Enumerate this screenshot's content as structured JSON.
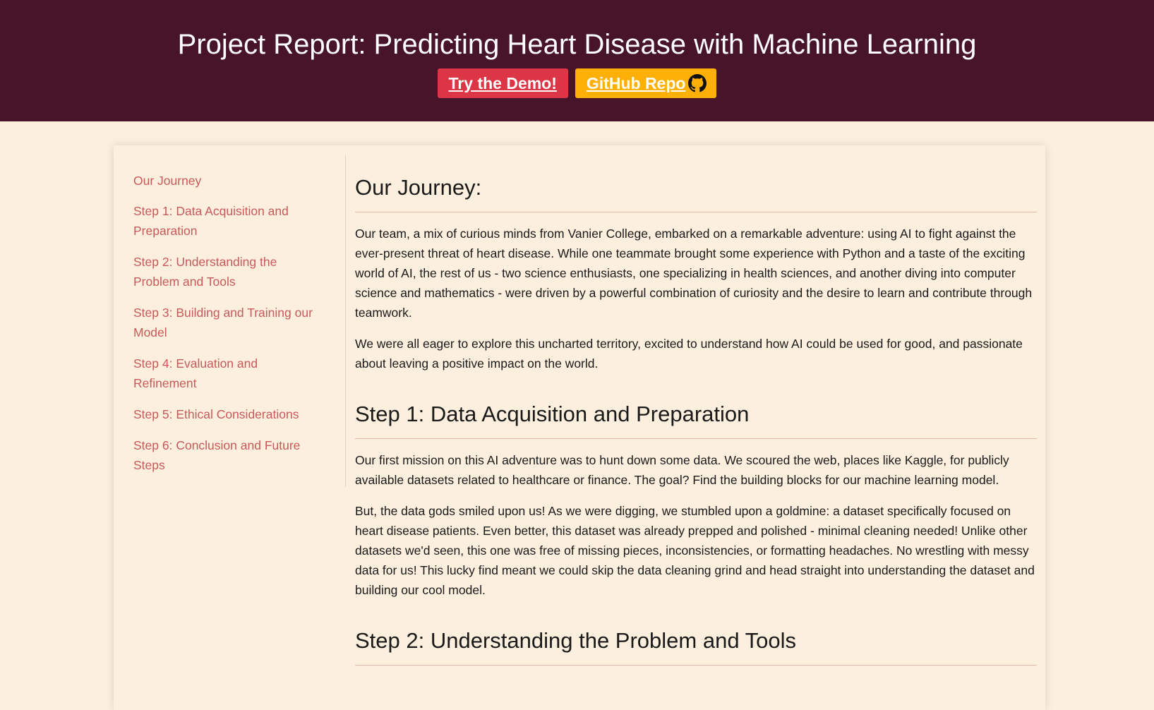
{
  "header": {
    "title": "Project Report: Predicting Heart Disease with Machine Learning",
    "demo_button": "Try the Demo!",
    "github_button": "GitHub Repo",
    "github_icon": "github-icon",
    "colors": {
      "header_bg": "#47142a",
      "demo_bg": "#dc3545",
      "github_bg": "#ffb007",
      "page_bg": "#fdefde",
      "link": "#c9595a"
    }
  },
  "sidebar": {
    "items": [
      {
        "label": "Our Journey"
      },
      {
        "label": "Step 1: Data Acquisition and Preparation"
      },
      {
        "label": "Step 2: Understanding the Problem and Tools"
      },
      {
        "label": "Step 3: Building and Training our Model"
      },
      {
        "label": "Step 4: Evaluation and Refinement"
      },
      {
        "label": "Step 5: Ethical Considerations"
      },
      {
        "label": "Step 6: Conclusion and Future Steps"
      }
    ]
  },
  "main": {
    "sections": [
      {
        "heading": "Our Journey:",
        "paragraphs": [
          "Our team, a mix of curious minds from Vanier College, embarked on a remarkable adventure: using AI to fight against the ever-present threat of heart disease. While one teammate brought some experience with Python and a taste of the exciting world of AI, the rest of us - two science enthusiasts, one specializing in health sciences, and another diving into computer science and mathematics - were driven by a powerful combination of curiosity and the desire to learn and contribute through teamwork.",
          "We were all eager to explore this uncharted territory, excited to understand how AI could be used for good, and passionate about leaving a positive impact on the world."
        ]
      },
      {
        "heading": "Step 1: Data Acquisition and Preparation",
        "paragraphs": [
          "Our first mission on this AI adventure was to hunt down some data. We scoured the web, places like Kaggle, for publicly available datasets related to healthcare or finance. The goal? Find the building blocks for our machine learning model.",
          "But, the data gods smiled upon us! As we were digging, we stumbled upon a goldmine: a dataset specifically focused on heart disease patients. Even better, this dataset was already prepped and polished - minimal cleaning needed! Unlike other datasets we'd seen, this one was free of missing pieces, inconsistencies, or formatting headaches. No wrestling with messy data for us! This lucky find meant we could skip the data cleaning grind and head straight into understanding the dataset and building our cool model."
        ]
      },
      {
        "heading": "Step 2: Understanding the Problem and Tools",
        "paragraphs": []
      }
    ]
  }
}
